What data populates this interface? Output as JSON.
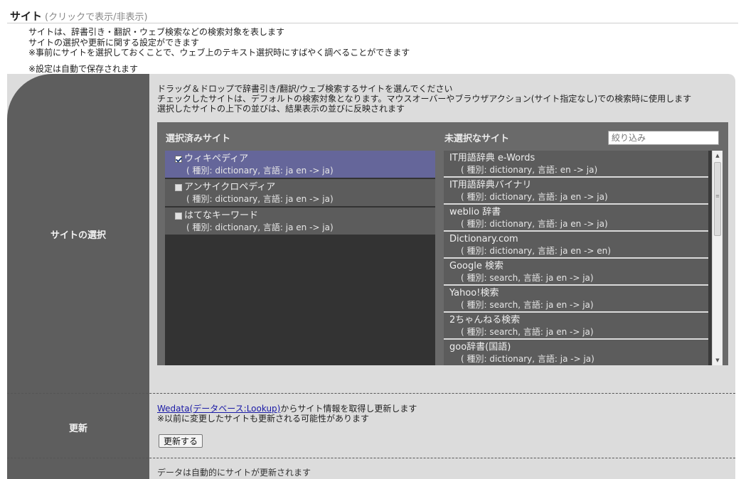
{
  "header": {
    "title": "サイト",
    "subtitle": "(クリックで表示/非表示)"
  },
  "description": {
    "line1": "サイトは、辞書引き・翻訳・ウェブ検索などの検索対象を表します",
    "line2": "サイトの選択や更新に関する設定ができます",
    "line3": "※事前にサイトを選択しておくことで、ウェブ上のテキスト選択時にすばやく調べることができます",
    "line4": "※設定は自動で保存されます"
  },
  "site_selection": {
    "label": "サイトの選択",
    "instructions": [
      "ドラッグ＆ドロップで辞書引き/翻訳/ウェブ検索するサイトを選んでください",
      "チェックしたサイトは、デフォルトの検索対象となります。マウスオーバーやブラウザアクション(サイト指定なし)での検索時に使用します",
      "選択したサイトの上下の並びは、結果表示の並びに反映されます"
    ],
    "selected_heading": "選択済みサイト",
    "unselected_heading": "未選択なサイト",
    "filter_placeholder": "絞り込み",
    "selected_sites": [
      {
        "name": "ウィキペディア",
        "meta": "( 種別: dictionary, 言語: ja en -> ja)",
        "checked": true
      },
      {
        "name": "アンサイクロペディア",
        "meta": "( 種別: dictionary, 言語: ja en -> ja)",
        "checked": false
      },
      {
        "name": "はてなキーワード",
        "meta": "( 種別: dictionary, 言語: ja en -> ja)",
        "checked": false
      }
    ],
    "unselected_sites": [
      {
        "name": "IT用語辞典 e-Words",
        "meta": "( 種別: dictionary, 言語: en -> ja)"
      },
      {
        "name": "IT用語辞典バイナリ",
        "meta": "( 種別: dictionary, 言語: ja en -> ja)"
      },
      {
        "name": "weblio 辞書",
        "meta": "( 種別: dictionary, 言語: ja en -> ja)"
      },
      {
        "name": "Dictionary.com",
        "meta": "( 種別: dictionary, 言語: ja en -> en)"
      },
      {
        "name": "Google 検索",
        "meta": "( 種別: search, 言語: ja en -> ja)"
      },
      {
        "name": "Yahoo!検索",
        "meta": "( 種別: search, 言語: ja en -> ja)"
      },
      {
        "name": "2ちゃんねる検索",
        "meta": "( 種別: search, 言語: ja en -> ja)"
      },
      {
        "name": "goo辞書(国語)",
        "meta": "( 種別: dictionary, 言語: ja -> ja)"
      }
    ]
  },
  "update": {
    "label": "更新",
    "link_text": "Wedata(データベース:Lookup)",
    "text_after_link": "からサイト情報を取得し更新します",
    "note": "※以前に変更したサイトも更新される可能性があります",
    "button_label": "更新する"
  },
  "next_section_partial": "データは自動的にサイトが更新されます",
  "colors": {
    "sidebar": "#5e5e5e",
    "panel": "#dcdcdc",
    "picker": "#6a6a6a",
    "selected_item": "#65669a",
    "list_item": "#5c5c5c",
    "link": "#1a1aa6"
  }
}
